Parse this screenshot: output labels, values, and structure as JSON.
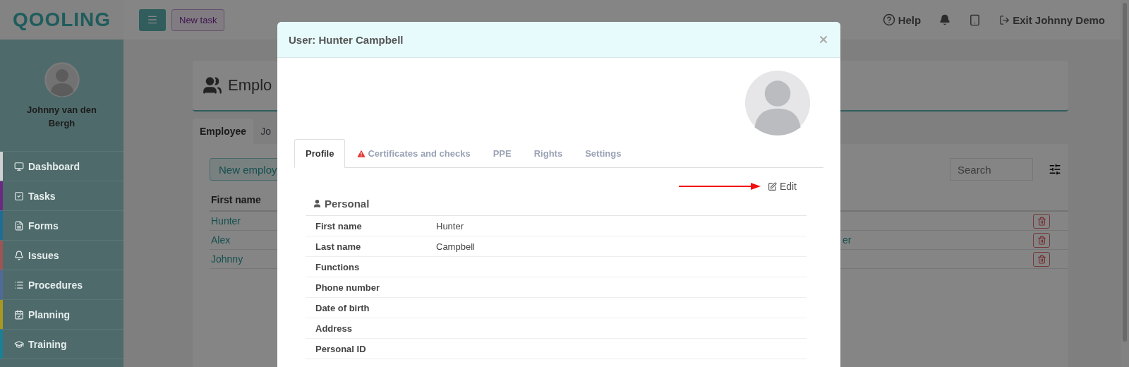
{
  "app": {
    "logo": "QOOLING"
  },
  "user": {
    "name": "Johnny van den Bergh"
  },
  "nav": [
    {
      "label": "Dashboard",
      "kind": "monitor",
      "color": "#d0d0d0"
    },
    {
      "label": "Tasks",
      "kind": "check",
      "color": "#6a2a84"
    },
    {
      "label": "Forms",
      "kind": "form",
      "color": "#1e6d96"
    },
    {
      "label": "Issues",
      "kind": "bell",
      "color": "#9e5454"
    },
    {
      "label": "Procedures",
      "kind": "list",
      "color": "#4e6a9a"
    },
    {
      "label": "Planning",
      "kind": "calendar",
      "color": "#a8981e"
    },
    {
      "label": "Training",
      "kind": "cap",
      "color": "#1a8096"
    }
  ],
  "topbar": {
    "new_task": "New task",
    "help": "Help",
    "exit": "Exit Johnny Demo"
  },
  "page": {
    "title": "Emplo",
    "tabs": [
      {
        "label": "Employee",
        "selected": true
      },
      {
        "label": "Jo",
        "selected": false
      }
    ],
    "new_button": "New employ",
    "search": {
      "placeholder": "Search"
    },
    "table": {
      "columns": [
        "First name"
      ],
      "rows": [
        {
          "first_name": "Hunter"
        },
        {
          "first_name": "Alex",
          "column_3": "er"
        },
        {
          "first_name": "Johnny"
        }
      ]
    }
  },
  "modal": {
    "title": "User: Hunter Campbell",
    "tabs": [
      {
        "label": "Profile",
        "selected": true,
        "warning": false
      },
      {
        "label": "Certificates and checks",
        "selected": false,
        "warning": true
      },
      {
        "label": "PPE",
        "selected": false,
        "warning": false
      },
      {
        "label": "Rights",
        "selected": false,
        "warning": false
      },
      {
        "label": "Settings",
        "selected": false,
        "warning": false
      }
    ],
    "edit": "Edit",
    "section": "Personal",
    "fields": [
      {
        "label": "First name",
        "value": "Hunter"
      },
      {
        "label": "Last name",
        "value": "Campbell"
      },
      {
        "label": "Functions"
      },
      {
        "label": "Phone number"
      },
      {
        "label": "Date of birth"
      },
      {
        "label": "Address"
      },
      {
        "label": "Personal ID"
      }
    ]
  }
}
